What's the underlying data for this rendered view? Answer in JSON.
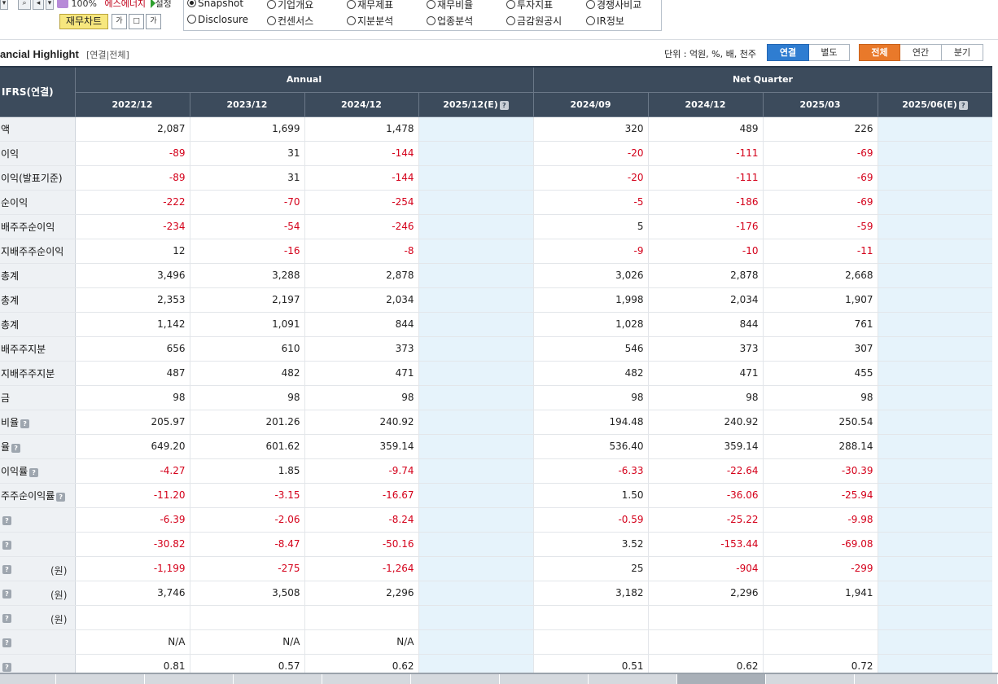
{
  "toolbar": {
    "zoom": "100%",
    "company": "에스에너지",
    "settings_label": "설정",
    "fin_chart_button": "재무차트",
    "icon1_label": "가",
    "icon2_label": "□",
    "icon3_label": "가"
  },
  "menu_options": [
    {
      "label": "Snapshot",
      "selected": true
    },
    {
      "label": "기업개요",
      "selected": false
    },
    {
      "label": "재무제표",
      "selected": false
    },
    {
      "label": "재무비율",
      "selected": false
    },
    {
      "label": "투자지표",
      "selected": false
    },
    {
      "label": "경쟁사비교",
      "selected": false
    },
    {
      "label": "Disclosure",
      "selected": false
    },
    {
      "label": "컨센서스",
      "selected": false
    },
    {
      "label": "지분분석",
      "selected": false
    },
    {
      "label": "업종분석",
      "selected": false
    },
    {
      "label": "금감원공시",
      "selected": false
    },
    {
      "label": "IR정보",
      "selected": false
    }
  ],
  "section": {
    "title": "ancial Highlight",
    "subtitle": "[연결|전체]",
    "unit_label": "단위 : 억원, %, 배, 천주"
  },
  "consolidation_toggle": [
    {
      "label": "연결",
      "active": true
    },
    {
      "label": "별도",
      "active": false
    }
  ],
  "period_toggle": [
    {
      "label": "전체",
      "active": true
    },
    {
      "label": "연간",
      "active": false
    },
    {
      "label": "분기",
      "active": false
    }
  ],
  "table": {
    "row_header": "IFRS(연결)",
    "group_annual": "Annual",
    "group_quarter": "Net Quarter",
    "columns": [
      "2022/12",
      "2023/12",
      "2024/12",
      "2025/12(E)",
      "2024/09",
      "2024/12",
      "2025/03",
      "2025/06(E)"
    ],
    "estimate_columns": [
      3,
      7
    ],
    "rows": [
      {
        "label": "액",
        "unit": "",
        "help": false,
        "values": [
          "2,087",
          "1,699",
          "1,478",
          "",
          "320",
          "489",
          "226",
          ""
        ]
      },
      {
        "label": "이익",
        "unit": "",
        "help": false,
        "values": [
          "-89",
          "31",
          "-144",
          "",
          "-20",
          "-111",
          "-69",
          ""
        ]
      },
      {
        "label": "이익(발표기준)",
        "unit": "",
        "help": false,
        "values": [
          "-89",
          "31",
          "-144",
          "",
          "-20",
          "-111",
          "-69",
          ""
        ]
      },
      {
        "label": "순이익",
        "unit": "",
        "help": false,
        "values": [
          "-222",
          "-70",
          "-254",
          "",
          "-5",
          "-186",
          "-69",
          ""
        ]
      },
      {
        "label": "배주주순이익",
        "unit": "",
        "help": false,
        "values": [
          "-234",
          "-54",
          "-246",
          "",
          "5",
          "-176",
          "-59",
          ""
        ]
      },
      {
        "label": "지배주주순이익",
        "unit": "",
        "help": false,
        "values": [
          "12",
          "-16",
          "-8",
          "",
          "-9",
          "-10",
          "-11",
          ""
        ]
      },
      {
        "label": "총계",
        "unit": "",
        "help": false,
        "values": [
          "3,496",
          "3,288",
          "2,878",
          "",
          "3,026",
          "2,878",
          "2,668",
          ""
        ]
      },
      {
        "label": "총계",
        "unit": "",
        "help": false,
        "values": [
          "2,353",
          "2,197",
          "2,034",
          "",
          "1,998",
          "2,034",
          "1,907",
          ""
        ]
      },
      {
        "label": "총계",
        "unit": "",
        "help": false,
        "values": [
          "1,142",
          "1,091",
          "844",
          "",
          "1,028",
          "844",
          "761",
          ""
        ]
      },
      {
        "label": "배주주지분",
        "unit": "",
        "help": false,
        "values": [
          "656",
          "610",
          "373",
          "",
          "546",
          "373",
          "307",
          ""
        ]
      },
      {
        "label": "지배주주지분",
        "unit": "",
        "help": false,
        "values": [
          "487",
          "482",
          "471",
          "",
          "482",
          "471",
          "455",
          ""
        ]
      },
      {
        "label": "금",
        "unit": "",
        "help": false,
        "values": [
          "98",
          "98",
          "98",
          "",
          "98",
          "98",
          "98",
          ""
        ]
      },
      {
        "label": "비율",
        "unit": "",
        "help": true,
        "values": [
          "205.97",
          "201.26",
          "240.92",
          "",
          "194.48",
          "240.92",
          "250.54",
          ""
        ]
      },
      {
        "label": "율",
        "unit": "",
        "help": true,
        "values": [
          "649.20",
          "601.62",
          "359.14",
          "",
          "536.40",
          "359.14",
          "288.14",
          ""
        ]
      },
      {
        "label": "이익률",
        "unit": "",
        "help": true,
        "values": [
          "-4.27",
          "1.85",
          "-9.74",
          "",
          "-6.33",
          "-22.64",
          "-30.39",
          ""
        ]
      },
      {
        "label": "주주순이익률",
        "unit": "",
        "help": true,
        "values": [
          "-11.20",
          "-3.15",
          "-16.67",
          "",
          "1.50",
          "-36.06",
          "-25.94",
          ""
        ]
      },
      {
        "label": "",
        "unit": "",
        "help": true,
        "values": [
          "-6.39",
          "-2.06",
          "-8.24",
          "",
          "-0.59",
          "-25.22",
          "-9.98",
          ""
        ]
      },
      {
        "label": "",
        "unit": "",
        "help": true,
        "values": [
          "-30.82",
          "-8.47",
          "-50.16",
          "",
          "3.52",
          "-153.44",
          "-69.08",
          ""
        ]
      },
      {
        "label": "",
        "unit": "(원)",
        "help": true,
        "values": [
          "-1,199",
          "-275",
          "-1,264",
          "",
          "25",
          "-904",
          "-299",
          ""
        ]
      },
      {
        "label": "",
        "unit": "(원)",
        "help": true,
        "values": [
          "3,746",
          "3,508",
          "2,296",
          "",
          "3,182",
          "2,296",
          "1,941",
          ""
        ]
      },
      {
        "label": "",
        "unit": "(원)",
        "help": true,
        "values": [
          "",
          "",
          "",
          "",
          "",
          "",
          "",
          ""
        ]
      },
      {
        "label": "",
        "unit": "",
        "help": true,
        "values": [
          "N/A",
          "N/A",
          "N/A",
          "",
          "",
          "",
          "",
          ""
        ]
      },
      {
        "label": "",
        "unit": "",
        "help": true,
        "values": [
          "0.81",
          "0.57",
          "0.62",
          "",
          "0.51",
          "0.62",
          "0.72",
          ""
        ]
      }
    ]
  },
  "colors": {
    "header_bg": "#3c4b5c",
    "negative": "#d4001a",
    "estimate_bg": "#e6f3fb",
    "toggle_blue": "#2f7dd1",
    "toggle_orange": "#e9792a"
  }
}
